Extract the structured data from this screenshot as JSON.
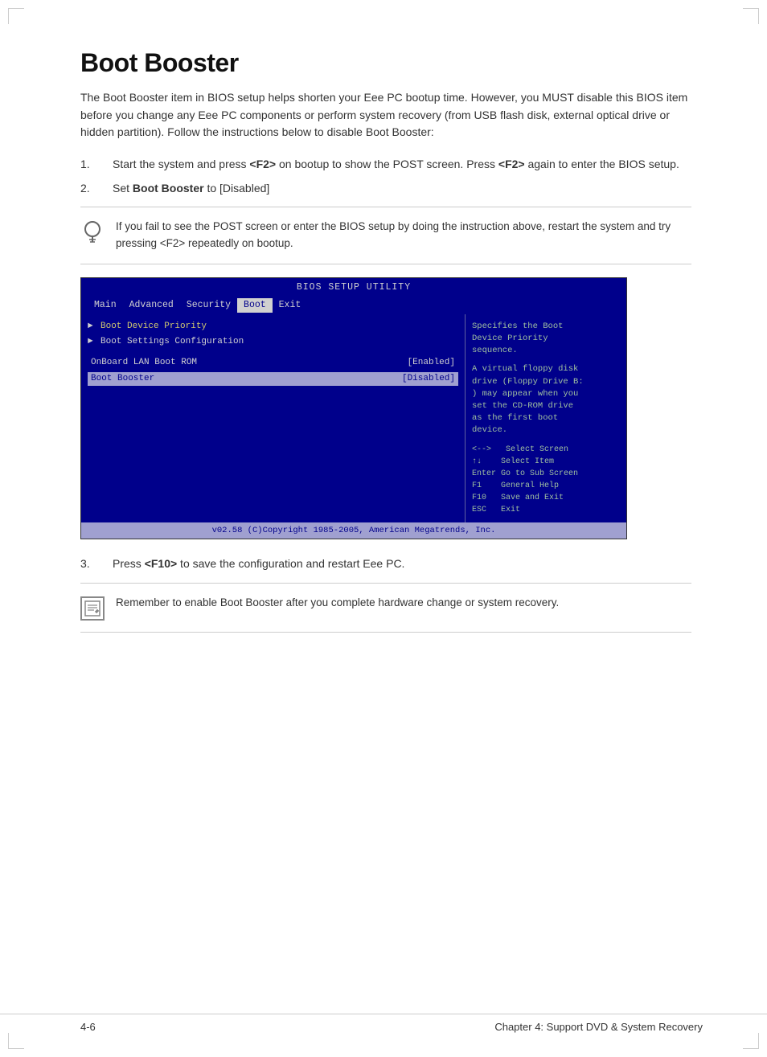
{
  "page": {
    "title": "Boot Booster",
    "body_intro": "The Boot Booster item in BIOS setup helps shorten your Eee PC bootup time. However, you MUST disable this BIOS item before you change any Eee PC components or perform system recovery (from USB flash disk, external optical drive or hidden partition). Follow the instructions below to disable Boot Booster:",
    "steps": [
      {
        "number": "1.",
        "text": "Start the system and press <F2> on bootup to show the POST screen. Press <F2> again to enter the BIOS setup."
      },
      {
        "number": "2.",
        "text": "Set Boot Booster to [Disabled]"
      },
      {
        "number": "3.",
        "text": "Press <F10> to save the configuration and restart Eee PC."
      }
    ],
    "tip": {
      "text": "If you fail to see the POST screen or enter the BIOS setup by doing the instruction above, restart the system and try pressing <F2> repeatedly on bootup."
    },
    "note": {
      "text": "Remember to enable Boot Booster after you complete hardware change or system recovery."
    },
    "bios": {
      "title": "BIOS SETUP UTILITY",
      "menu_items": [
        "Main",
        "Advanced",
        "Security",
        "Boot",
        "Exit"
      ],
      "active_menu": "Boot",
      "items": [
        {
          "arrow": true,
          "label": "Boot Device Priority"
        },
        {
          "arrow": true,
          "label": "Boot Settings Configuration"
        }
      ],
      "settings": [
        {
          "name": "OnBoard LAN Boot ROM",
          "value": "[Enabled]",
          "highlighted": false
        },
        {
          "name": "Boot Booster",
          "value": "[Disabled]",
          "highlighted": true
        }
      ],
      "right_text": "Specifies the Boot\nDevice Priority\nsequence.\n\nA virtual floppy disk\ndrive (Floppy Drive B:\n) may appear when you\nset the CD-ROM drive\nas the first boot\ndevice.",
      "keys": "<-->  Select Screen\n↑↓   Select Item\nEnter Go to Sub Screen\nF1   General Help\nF10  Save and Exit\nESC  Exit",
      "footer": "v02.58 (C)Copyright 1985-2005, American Megatrends, Inc."
    },
    "footer": {
      "left": "4-6",
      "right": "Chapter 4: Support DVD & System Recovery"
    }
  }
}
